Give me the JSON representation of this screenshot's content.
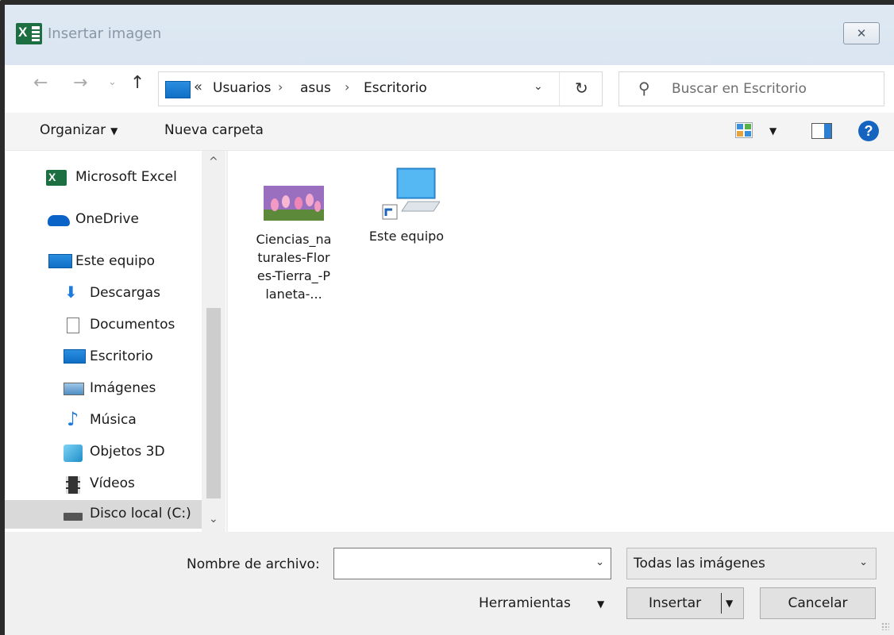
{
  "window": {
    "title": "Insertar imagen",
    "close_glyph": "✕"
  },
  "nav": {
    "back_glyph": "←",
    "forward_glyph": "→",
    "recent_glyph": "⌄",
    "up_glyph": "↑",
    "breadcrumb_overflow": "«",
    "breadcrumbs": [
      "Usuarios",
      "asus",
      "Escritorio"
    ],
    "separator": "›",
    "dropdown_glyph": "⌄",
    "refresh_glyph": "↻",
    "search_placeholder": "Buscar en Escritorio"
  },
  "toolbar": {
    "organize_label": "Organizar",
    "organize_caret": "▼",
    "new_folder_label": "Nueva carpeta",
    "view_caret": "▼",
    "help_glyph": "?"
  },
  "sidebar": {
    "items": [
      {
        "label": "Microsoft Excel",
        "icon": "excel-icon"
      },
      {
        "label": "OneDrive",
        "icon": "cloud-icon"
      },
      {
        "label": "Este equipo",
        "icon": "computer-icon"
      },
      {
        "label": "Descargas",
        "icon": "download-icon"
      },
      {
        "label": "Documentos",
        "icon": "document-icon"
      },
      {
        "label": "Escritorio",
        "icon": "desktop-icon"
      },
      {
        "label": "Imágenes",
        "icon": "pictures-icon"
      },
      {
        "label": "Música",
        "icon": "music-icon"
      },
      {
        "label": "Objetos 3D",
        "icon": "objects-3d-icon"
      },
      {
        "label": "Vídeos",
        "icon": "video-icon"
      },
      {
        "label": "Disco local (C:)",
        "icon": "drive-icon",
        "selected": true
      }
    ],
    "scroll_up_glyph": "^",
    "scroll_down_glyph": "⌄"
  },
  "files": [
    {
      "label": "Ciencias_naturales-Flores-Tierra_-Planeta-...",
      "icon": "image-thumbnail-icon"
    },
    {
      "label": "Este equipo",
      "icon": "computer-shortcut-icon"
    }
  ],
  "footer": {
    "filename_label": "Nombre de archivo:",
    "filename_value": "",
    "filename_dropdown_glyph": "⌄",
    "filter_value": "Todas las imágenes",
    "filter_dropdown_glyph": "⌄",
    "tools_label": "Herramientas",
    "tools_caret": "▼",
    "insert_label": "Insertar",
    "insert_caret": "▼",
    "cancel_label": "Cancelar"
  },
  "colors": {
    "accent": "#1565c0",
    "excel_green": "#1d6f42",
    "titlebar": "#dae5f1",
    "selected_row": "#d9d9d9"
  }
}
